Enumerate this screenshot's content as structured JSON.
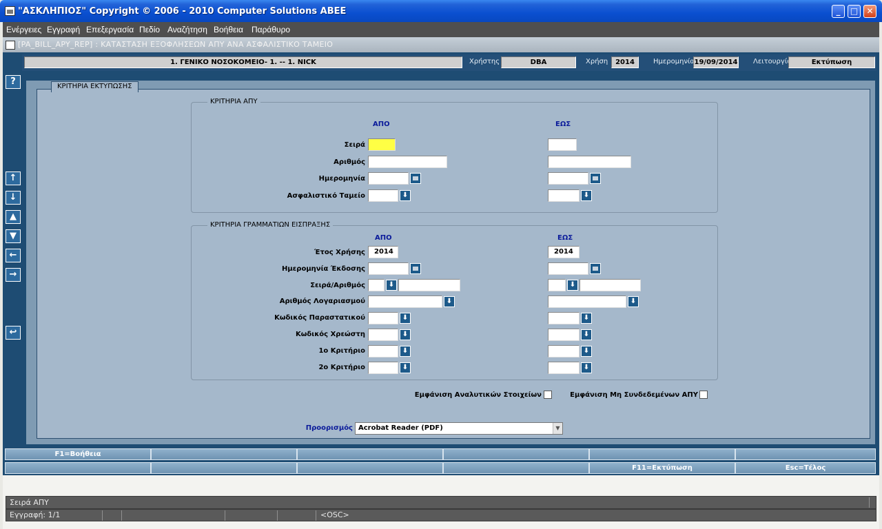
{
  "window": {
    "title": "\"ΑΣΚΛΗΠΙΟΣ\" Copyright © 2006 - 2010 Computer Solutions ABEE",
    "minimize": "_",
    "maximize": "□",
    "close": "✕"
  },
  "menu": [
    "Ενέργειες",
    "Εγγραφή",
    "Επεξεργασία",
    "Πεδίο",
    "Αναζήτηση",
    "Βοήθεια",
    "Παράθυρο"
  ],
  "form": {
    "title": "[PA_BILL_APY_REP]  :  ΚΑΤΑΣΤΑΣΗ ΕΞΟΦΛΗΣΕΩΝ ΑΠΥ ΑΝΑ ΑΣΦΑΛΙΣΤΙΚΟ ΤΑΜΕΙΟ"
  },
  "info": {
    "hospital": "1. ΓΕΝΙΚΟ ΝΟΣΟΚΟΜΕΙΟ- 1. -- 1. NICK",
    "user_label": "Χρήστης",
    "user": "DBA",
    "year_label": "Χρήση",
    "year": "2014",
    "date_label": "Ημερομηνία",
    "date": "19/09/2014",
    "mode_label": "Λειτουργία",
    "mode": "Εκτύπωση"
  },
  "sidebar": {
    "help": "?",
    "icons": [
      "↑",
      "↓",
      "▲",
      "▼",
      "←",
      "→",
      "↩"
    ]
  },
  "panel": {
    "tab": "ΚΡΙΤΗΡΙΑ ΕΚΤΥΠΩΣΗΣ",
    "group1": {
      "title": "ΚΡΙΤΗΡΙΑ ΑΠΥ",
      "from": "ΑΠΟ",
      "to": "ΕΩΣ",
      "labels": [
        "Σειρά",
        "Αριθμός",
        "Ημερομηνία",
        "Ασφαλιστικό Ταμείο"
      ]
    },
    "group2": {
      "title": "ΚΡΙΤΗΡΙΑ ΓΡΑΜΜΑΤΙΩΝ ΕΙΣΠΡΑΞΗΣ",
      "from": "ΑΠΟ",
      "to": "ΕΩΣ",
      "labels": [
        "Έτος Χρήσης",
        "Ημερομηνία Έκδοσης",
        "Σειρά/Αριθμός",
        "Αριθμός Λογαριασμού",
        "Κωδικός Παραστατικού",
        "Κωδικός Χρεώστη",
        "1ο Κριτήριο",
        "2ο Κριτήριο"
      ],
      "year_from": "2014",
      "year_to": "2014"
    },
    "show_details": "Εμφάνιση Αναλυτικών Στοιχείων",
    "show_unlinked": "Εμφάνιση Μη Συνδεδεμένων ΑΠΥ",
    "destination_label": "Προορισμός",
    "destination": "Acrobat Reader (PDF)"
  },
  "fkeys": {
    "row1": [
      "F1=Βοήθεια",
      "",
      "",
      "",
      "",
      ""
    ],
    "row2": [
      "",
      "",
      "",
      "",
      "F11=Εκτύπωση",
      "Esc=Τέλος"
    ]
  },
  "status": {
    "message": "Σειρά ΑΠΥ",
    "record": "Εγγραφή: 1/1",
    "osc": "<OSC>"
  },
  "colors": {
    "titlebar": "#0a4fd0",
    "main": "#1e4c73",
    "panel": "#a5b8cb",
    "highlight": "#ffff44",
    "column_header": "#0a1a9a"
  }
}
